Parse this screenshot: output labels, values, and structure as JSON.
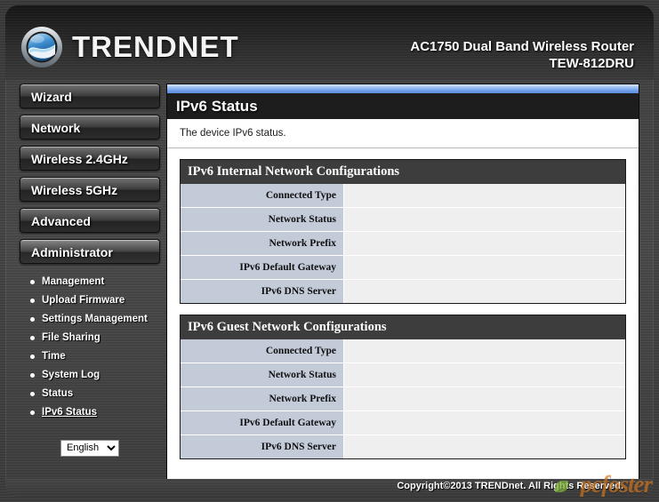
{
  "header": {
    "brand": "TRENDNET",
    "logo_icon": "trendnet-globe-icon",
    "product_line": "AC1750 Dual Band Wireless Router",
    "model": "TEW-812DRU"
  },
  "sidebar": {
    "buttons": [
      {
        "label": "Wizard"
      },
      {
        "label": "Network"
      },
      {
        "label": "Wireless 2.4GHz"
      },
      {
        "label": "Wireless 5GHz"
      },
      {
        "label": "Advanced"
      },
      {
        "label": "Administrator"
      }
    ],
    "submenu": [
      {
        "label": "Management",
        "selected": false
      },
      {
        "label": "Upload Firmware",
        "selected": false
      },
      {
        "label": "Settings Management",
        "selected": false
      },
      {
        "label": "File Sharing",
        "selected": false
      },
      {
        "label": "Time",
        "selected": false
      },
      {
        "label": "System Log",
        "selected": false
      },
      {
        "label": "Status",
        "selected": false
      },
      {
        "label": "IPv6 Status",
        "selected": true
      }
    ],
    "language": {
      "selected": "English",
      "options": [
        "English"
      ]
    }
  },
  "main": {
    "page_title": "IPv6 Status",
    "description": "The device IPv6 status.",
    "sections": [
      {
        "title": "IPv6 Internal Network Configurations",
        "rows": [
          {
            "label": "Connected Type",
            "value": ""
          },
          {
            "label": "Network Status",
            "value": ""
          },
          {
            "label": "Network Prefix",
            "value": ""
          },
          {
            "label": "IPv6 Default Gateway",
            "value": ""
          },
          {
            "label": "IPv6 DNS Server",
            "value": ""
          }
        ]
      },
      {
        "title": "IPv6 Guest Network Configurations",
        "rows": [
          {
            "label": "Connected Type",
            "value": ""
          },
          {
            "label": "Network Status",
            "value": ""
          },
          {
            "label": "Network Prefix",
            "value": ""
          },
          {
            "label": "IPv6 Default Gateway",
            "value": ""
          },
          {
            "label": "IPv6 DNS Server",
            "value": ""
          }
        ]
      }
    ]
  },
  "footer": {
    "copyright": "Copyright©2013 TRENDnet. All Rights Reserved.",
    "watermark": "pcfoster"
  },
  "colors": {
    "accent_blue": "#6f9de8",
    "panel_bg": "#ffffff",
    "card_head": "#3d3d3d",
    "key_cell": "#c3cbd9",
    "value_cell": "#efefef",
    "chassis": "#454545"
  }
}
